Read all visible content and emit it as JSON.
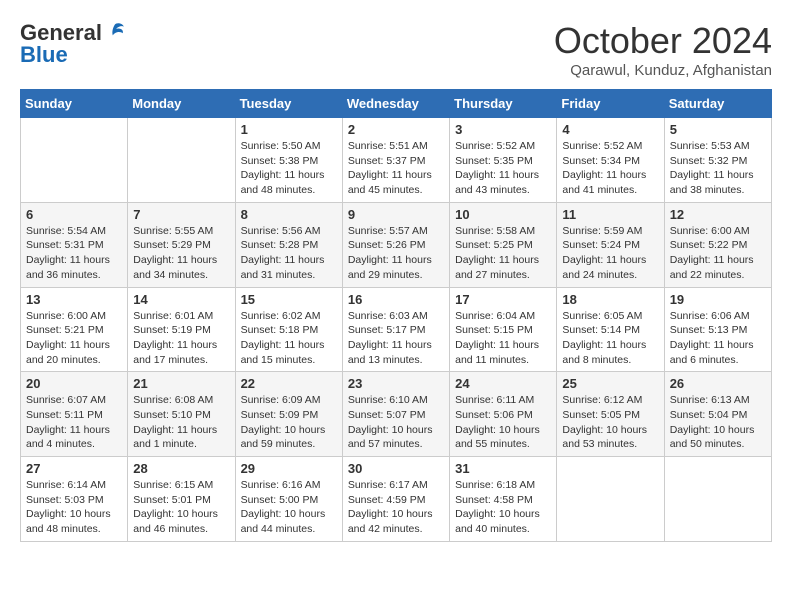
{
  "header": {
    "logo_general": "General",
    "logo_blue": "Blue",
    "month_title": "October 2024",
    "location": "Qarawul, Kunduz, Afghanistan"
  },
  "weekdays": [
    "Sunday",
    "Monday",
    "Tuesday",
    "Wednesday",
    "Thursday",
    "Friday",
    "Saturday"
  ],
  "weeks": [
    [
      {
        "day": null,
        "info": null
      },
      {
        "day": null,
        "info": null
      },
      {
        "day": "1",
        "info": "Sunrise: 5:50 AM\nSunset: 5:38 PM\nDaylight: 11 hours and 48 minutes."
      },
      {
        "day": "2",
        "info": "Sunrise: 5:51 AM\nSunset: 5:37 PM\nDaylight: 11 hours and 45 minutes."
      },
      {
        "day": "3",
        "info": "Sunrise: 5:52 AM\nSunset: 5:35 PM\nDaylight: 11 hours and 43 minutes."
      },
      {
        "day": "4",
        "info": "Sunrise: 5:52 AM\nSunset: 5:34 PM\nDaylight: 11 hours and 41 minutes."
      },
      {
        "day": "5",
        "info": "Sunrise: 5:53 AM\nSunset: 5:32 PM\nDaylight: 11 hours and 38 minutes."
      }
    ],
    [
      {
        "day": "6",
        "info": "Sunrise: 5:54 AM\nSunset: 5:31 PM\nDaylight: 11 hours and 36 minutes."
      },
      {
        "day": "7",
        "info": "Sunrise: 5:55 AM\nSunset: 5:29 PM\nDaylight: 11 hours and 34 minutes."
      },
      {
        "day": "8",
        "info": "Sunrise: 5:56 AM\nSunset: 5:28 PM\nDaylight: 11 hours and 31 minutes."
      },
      {
        "day": "9",
        "info": "Sunrise: 5:57 AM\nSunset: 5:26 PM\nDaylight: 11 hours and 29 minutes."
      },
      {
        "day": "10",
        "info": "Sunrise: 5:58 AM\nSunset: 5:25 PM\nDaylight: 11 hours and 27 minutes."
      },
      {
        "day": "11",
        "info": "Sunrise: 5:59 AM\nSunset: 5:24 PM\nDaylight: 11 hours and 24 minutes."
      },
      {
        "day": "12",
        "info": "Sunrise: 6:00 AM\nSunset: 5:22 PM\nDaylight: 11 hours and 22 minutes."
      }
    ],
    [
      {
        "day": "13",
        "info": "Sunrise: 6:00 AM\nSunset: 5:21 PM\nDaylight: 11 hours and 20 minutes."
      },
      {
        "day": "14",
        "info": "Sunrise: 6:01 AM\nSunset: 5:19 PM\nDaylight: 11 hours and 17 minutes."
      },
      {
        "day": "15",
        "info": "Sunrise: 6:02 AM\nSunset: 5:18 PM\nDaylight: 11 hours and 15 minutes."
      },
      {
        "day": "16",
        "info": "Sunrise: 6:03 AM\nSunset: 5:17 PM\nDaylight: 11 hours and 13 minutes."
      },
      {
        "day": "17",
        "info": "Sunrise: 6:04 AM\nSunset: 5:15 PM\nDaylight: 11 hours and 11 minutes."
      },
      {
        "day": "18",
        "info": "Sunrise: 6:05 AM\nSunset: 5:14 PM\nDaylight: 11 hours and 8 minutes."
      },
      {
        "day": "19",
        "info": "Sunrise: 6:06 AM\nSunset: 5:13 PM\nDaylight: 11 hours and 6 minutes."
      }
    ],
    [
      {
        "day": "20",
        "info": "Sunrise: 6:07 AM\nSunset: 5:11 PM\nDaylight: 11 hours and 4 minutes."
      },
      {
        "day": "21",
        "info": "Sunrise: 6:08 AM\nSunset: 5:10 PM\nDaylight: 11 hours and 1 minute."
      },
      {
        "day": "22",
        "info": "Sunrise: 6:09 AM\nSunset: 5:09 PM\nDaylight: 10 hours and 59 minutes."
      },
      {
        "day": "23",
        "info": "Sunrise: 6:10 AM\nSunset: 5:07 PM\nDaylight: 10 hours and 57 minutes."
      },
      {
        "day": "24",
        "info": "Sunrise: 6:11 AM\nSunset: 5:06 PM\nDaylight: 10 hours and 55 minutes."
      },
      {
        "day": "25",
        "info": "Sunrise: 6:12 AM\nSunset: 5:05 PM\nDaylight: 10 hours and 53 minutes."
      },
      {
        "day": "26",
        "info": "Sunrise: 6:13 AM\nSunset: 5:04 PM\nDaylight: 10 hours and 50 minutes."
      }
    ],
    [
      {
        "day": "27",
        "info": "Sunrise: 6:14 AM\nSunset: 5:03 PM\nDaylight: 10 hours and 48 minutes."
      },
      {
        "day": "28",
        "info": "Sunrise: 6:15 AM\nSunset: 5:01 PM\nDaylight: 10 hours and 46 minutes."
      },
      {
        "day": "29",
        "info": "Sunrise: 6:16 AM\nSunset: 5:00 PM\nDaylight: 10 hours and 44 minutes."
      },
      {
        "day": "30",
        "info": "Sunrise: 6:17 AM\nSunset: 4:59 PM\nDaylight: 10 hours and 42 minutes."
      },
      {
        "day": "31",
        "info": "Sunrise: 6:18 AM\nSunset: 4:58 PM\nDaylight: 10 hours and 40 minutes."
      },
      {
        "day": null,
        "info": null
      },
      {
        "day": null,
        "info": null
      }
    ]
  ]
}
